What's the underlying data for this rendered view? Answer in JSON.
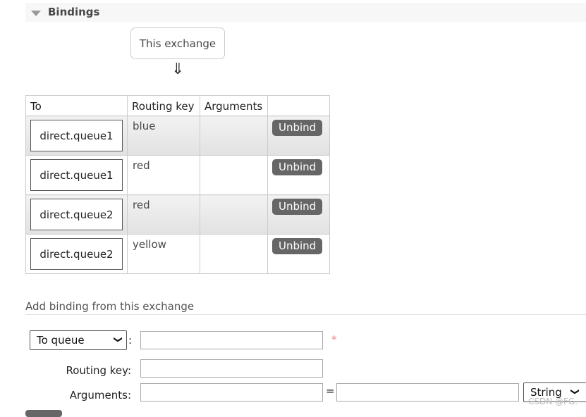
{
  "section": {
    "title": "Bindings",
    "icon": "triangle-down-icon"
  },
  "source": {
    "label": "This exchange",
    "arrow": "⇓"
  },
  "table": {
    "headers": [
      "To",
      "Routing key",
      "Arguments",
      ""
    ],
    "rows": [
      {
        "to": "direct.queue1",
        "routing_key": "blue",
        "arguments": "",
        "action": "Unbind"
      },
      {
        "to": "direct.queue1",
        "routing_key": "red",
        "arguments": "",
        "action": "Unbind"
      },
      {
        "to": "direct.queue2",
        "routing_key": "red",
        "arguments": "",
        "action": "Unbind"
      },
      {
        "to": "direct.queue2",
        "routing_key": "yellow",
        "arguments": "",
        "action": "Unbind"
      }
    ]
  },
  "form": {
    "title": "Add binding from this exchange",
    "destination_type": "To queue",
    "colon": ":",
    "required": "*",
    "routing_key_label": "Routing key:",
    "arguments_label": "Arguments:",
    "equals": "=",
    "arg_type": "String",
    "destination_value": "",
    "routing_key_value": "",
    "arg_key": "",
    "arg_value": ""
  },
  "watermark": "CSDN @FG.",
  "colors": {
    "unbind_bg": "#666666",
    "required": "#f08090"
  }
}
